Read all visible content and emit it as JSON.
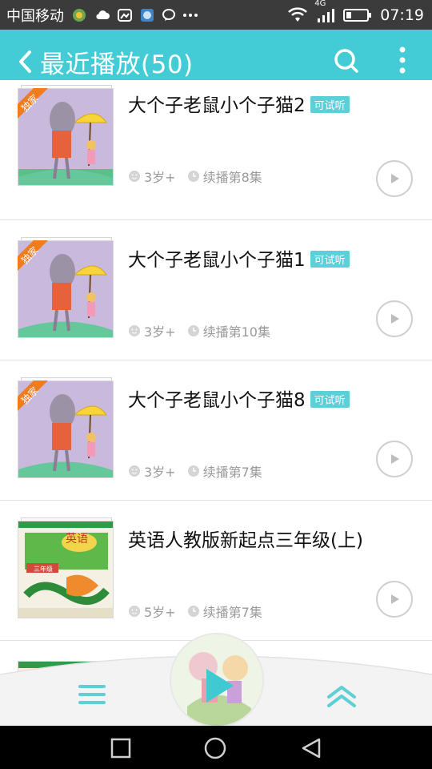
{
  "statusbar": {
    "carrier": "中国移动",
    "network": "4G",
    "time": "07:19",
    "icons": [
      "app-icon-1",
      "cloud-icon",
      "photo-icon",
      "app-icon-2",
      "chat-icon",
      "more-dots-icon",
      "wifi-icon",
      "signal-icon",
      "battery-icon"
    ]
  },
  "header": {
    "title": "最近播放(50)",
    "back_icon": "chevron-left-icon",
    "search_icon": "search-icon",
    "more_icon": "more-vertical-icon",
    "color": "#44ccd6"
  },
  "items": [
    {
      "title": "大个子老鼠小个子猫2",
      "badge": "可试听",
      "cover_tag": "独家",
      "age": "3岁+",
      "progress": "续播第8集"
    },
    {
      "title": "大个子老鼠小个子猫1",
      "badge": "可试听",
      "cover_tag": "独家",
      "age": "3岁+",
      "progress": "续播第10集"
    },
    {
      "title": "大个子老鼠小个子猫8",
      "badge": "可试听",
      "cover_tag": "独家",
      "age": "3岁+",
      "progress": "续播第7集"
    },
    {
      "title": "英语人教版新起点三年级(上)",
      "badge": "",
      "cover_text": "英语",
      "cover_grade": "三年级",
      "age": "5岁+",
      "progress": "续播第7集"
    }
  ],
  "player": {
    "menu_icon": "menu-icon",
    "play_icon": "play-icon",
    "collapse_icon": "double-chevron-up-icon"
  },
  "navbar": {
    "icons": [
      "recent-apps-icon",
      "home-icon",
      "back-icon"
    ]
  },
  "colors": {
    "accent": "#44ccd6",
    "badge": "#5ccfd8",
    "cover_tag": "#f07c1e"
  }
}
